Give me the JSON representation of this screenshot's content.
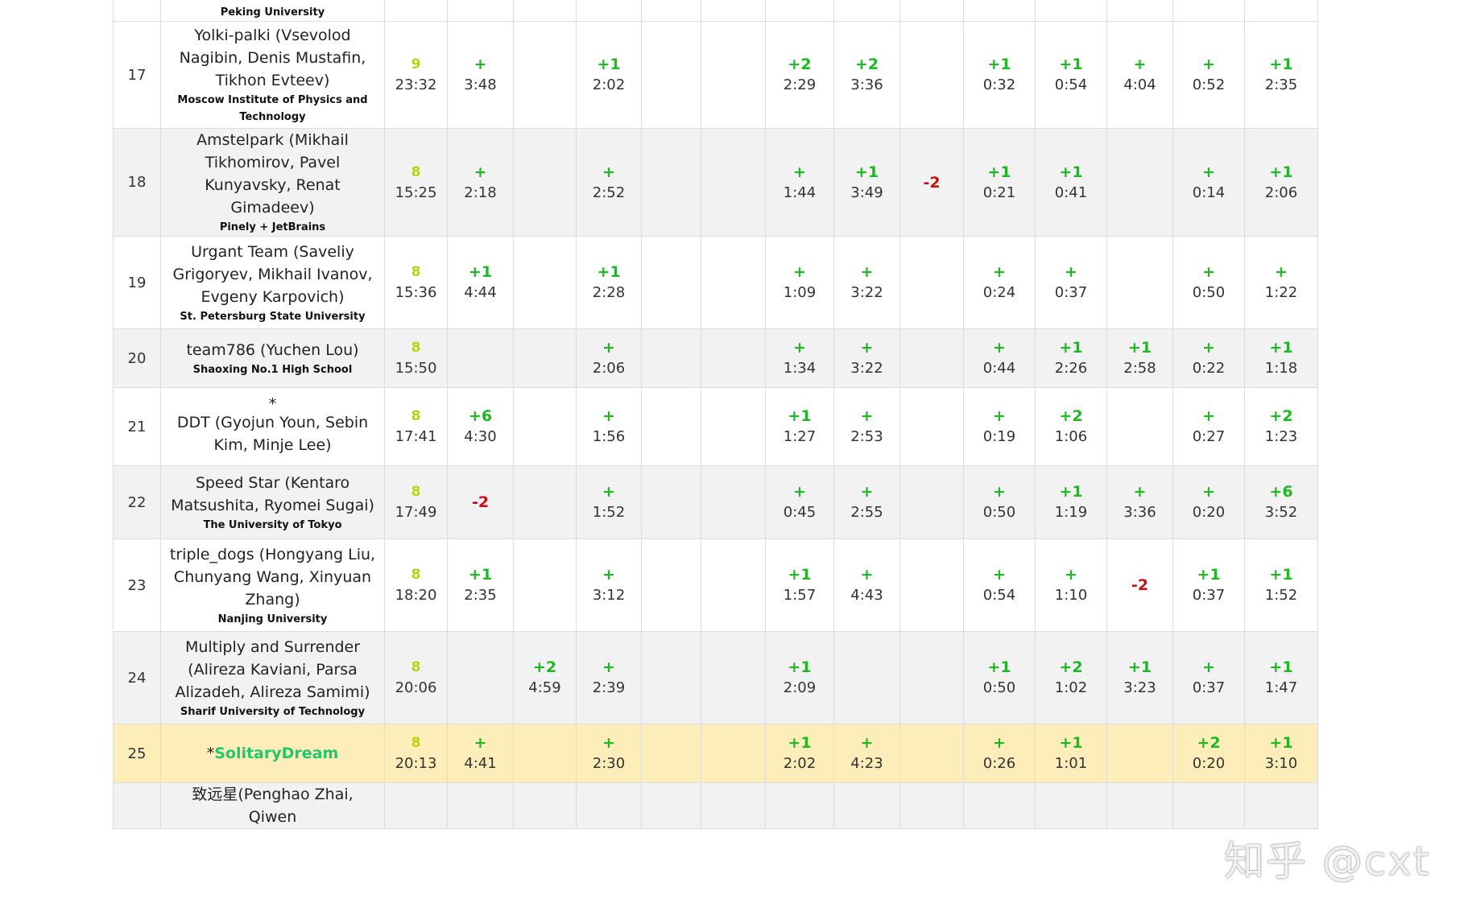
{
  "colors": {
    "solved": "#b8d21a",
    "accepted": "#1db822",
    "failed": "#c81010",
    "highlight_row": "#fdedb9",
    "highlight_team": "#22c76b"
  },
  "scoreboard": {
    "rows": [
      {
        "rank": "",
        "team": "",
        "affiliation": "Peking University",
        "solved": "",
        "penalty": "",
        "problems": [
          null,
          null,
          null,
          null,
          null,
          null,
          null,
          null,
          null,
          null,
          null,
          null,
          null,
          null
        ]
      },
      {
        "rank": "17",
        "team": "Yolki-palki (Vsevolod Nagibin, Denis Mustafin, Tikhon Evteev)",
        "affiliation": "Moscow Institute of Physics and Technology",
        "solved": "9",
        "penalty": "23:32",
        "problems": [
          {
            "r": "+",
            "t": "3:48"
          },
          null,
          {
            "r": "+1",
            "t": "2:02"
          },
          null,
          null,
          {
            "r": "+2",
            "t": "2:29"
          },
          {
            "r": "+2",
            "t": "3:36"
          },
          null,
          {
            "r": "+1",
            "t": "0:32"
          },
          {
            "r": "+1",
            "t": "0:54"
          },
          {
            "r": "+",
            "t": "4:04"
          },
          {
            "r": "+",
            "t": "0:52"
          },
          {
            "r": "+1",
            "t": "2:35"
          }
        ]
      },
      {
        "rank": "18",
        "team": "Amstelpark (Mikhail Tikhomirov, Pavel Kunyavsky, Renat Gimadeev)",
        "affiliation": "Pinely + JetBrains",
        "solved": "8",
        "penalty": "15:25",
        "problems": [
          {
            "r": "+",
            "t": "2:18"
          },
          null,
          {
            "r": "+",
            "t": "2:52"
          },
          null,
          null,
          {
            "r": "+",
            "t": "1:44"
          },
          {
            "r": "+1",
            "t": "3:49"
          },
          {
            "f": "-2"
          },
          {
            "r": "+1",
            "t": "0:21"
          },
          {
            "r": "+1",
            "t": "0:41"
          },
          null,
          {
            "r": "+",
            "t": "0:14"
          },
          {
            "r": "+1",
            "t": "2:06"
          }
        ]
      },
      {
        "rank": "19",
        "team": "Urgant Team (Saveliy Grigoryev, Mikhail Ivanov, Evgeny Karpovich)",
        "affiliation": "St. Petersburg State University",
        "solved": "8",
        "penalty": "15:36",
        "problems": [
          {
            "r": "+1",
            "t": "4:44"
          },
          null,
          {
            "r": "+1",
            "t": "2:28"
          },
          null,
          null,
          {
            "r": "+",
            "t": "1:09"
          },
          {
            "r": "+",
            "t": "3:22"
          },
          null,
          {
            "r": "+",
            "t": "0:24"
          },
          {
            "r": "+",
            "t": "0:37"
          },
          null,
          {
            "r": "+",
            "t": "0:50"
          },
          {
            "r": "+",
            "t": "1:22"
          }
        ]
      },
      {
        "rank": "20",
        "team": "team786 (Yuchen Lou)",
        "affiliation": "Shaoxing No.1 High School",
        "solved": "8",
        "penalty": "15:50",
        "problems": [
          null,
          null,
          {
            "r": "+",
            "t": "2:06"
          },
          null,
          null,
          {
            "r": "+",
            "t": "1:34"
          },
          {
            "r": "+",
            "t": "3:22"
          },
          null,
          {
            "r": "+",
            "t": "0:44"
          },
          {
            "r": "+1",
            "t": "2:26"
          },
          {
            "r": "+1",
            "t": "2:58"
          },
          {
            "r": "+",
            "t": "0:22"
          },
          {
            "r": "+1",
            "t": "1:18"
          }
        ]
      },
      {
        "rank": "21",
        "star": "*",
        "team": "DDT (Gyojun Youn, Sebin Kim, Minje Lee)",
        "affiliation": "",
        "solved": "8",
        "penalty": "17:41",
        "problems": [
          {
            "r": "+6",
            "t": "4:30"
          },
          null,
          {
            "r": "+",
            "t": "1:56"
          },
          null,
          null,
          {
            "r": "+1",
            "t": "1:27"
          },
          {
            "r": "+",
            "t": "2:53"
          },
          null,
          {
            "r": "+",
            "t": "0:19"
          },
          {
            "r": "+2",
            "t": "1:06"
          },
          null,
          {
            "r": "+",
            "t": "0:27"
          },
          {
            "r": "+2",
            "t": "1:23"
          }
        ]
      },
      {
        "rank": "22",
        "team": "Speed Star (Kentaro Matsushita, Ryomei Sugai)",
        "affiliation": "The University of Tokyo",
        "solved": "8",
        "penalty": "17:49",
        "problems": [
          {
            "f": "-2"
          },
          null,
          {
            "r": "+",
            "t": "1:52"
          },
          null,
          null,
          {
            "r": "+",
            "t": "0:45"
          },
          {
            "r": "+",
            "t": "2:55"
          },
          null,
          {
            "r": "+",
            "t": "0:50"
          },
          {
            "r": "+1",
            "t": "1:19"
          },
          {
            "r": "+",
            "t": "3:36"
          },
          {
            "r": "+",
            "t": "0:20"
          },
          {
            "r": "+6",
            "t": "3:52"
          }
        ]
      },
      {
        "rank": "23",
        "team": "triple_dogs (Hongyang Liu, Chunyang Wang, Xinyuan Zhang)",
        "affiliation": "Nanjing University",
        "solved": "8",
        "penalty": "18:20",
        "problems": [
          {
            "r": "+1",
            "t": "2:35"
          },
          null,
          {
            "r": "+",
            "t": "3:12"
          },
          null,
          null,
          {
            "r": "+1",
            "t": "1:57"
          },
          {
            "r": "+",
            "t": "4:43"
          },
          null,
          {
            "r": "+",
            "t": "0:54"
          },
          {
            "r": "+",
            "t": "1:10"
          },
          {
            "f": "-2"
          },
          {
            "r": "+1",
            "t": "0:37"
          },
          {
            "r": "+1",
            "t": "1:52"
          }
        ]
      },
      {
        "rank": "24",
        "team": "Multiply and Surrender (Alireza Kaviani, Parsa Alizadeh, Alireza Samimi)",
        "affiliation": "Sharif University of Technology",
        "solved": "8",
        "penalty": "20:06",
        "problems": [
          null,
          {
            "r": "+2",
            "t": "4:59"
          },
          {
            "r": "+",
            "t": "2:39"
          },
          null,
          null,
          {
            "r": "+1",
            "t": "2:09"
          },
          null,
          null,
          {
            "r": "+1",
            "t": "0:50"
          },
          {
            "r": "+2",
            "t": "1:02"
          },
          {
            "r": "+1",
            "t": "3:23"
          },
          {
            "r": "+",
            "t": "0:37"
          },
          {
            "r": "+1",
            "t": "1:47"
          }
        ]
      },
      {
        "rank": "25",
        "star": "*",
        "team": "SolitaryDream",
        "affiliation": "",
        "solved": "8",
        "penalty": "20:13",
        "highlight": true,
        "problems": [
          {
            "r": "+",
            "t": "4:41"
          },
          null,
          {
            "r": "+",
            "t": "2:30"
          },
          null,
          null,
          {
            "r": "+1",
            "t": "2:02"
          },
          {
            "r": "+",
            "t": "4:23"
          },
          null,
          {
            "r": "+",
            "t": "0:26"
          },
          {
            "r": "+1",
            "t": "1:01"
          },
          null,
          {
            "r": "+2",
            "t": "0:20"
          },
          {
            "r": "+1",
            "t": "3:10"
          }
        ]
      },
      {
        "rank": "",
        "team": "致远星(Penghao Zhai, Qiwen",
        "affiliation": "",
        "solved": "",
        "penalty": "",
        "problems": [
          null,
          null,
          null,
          null,
          null,
          null,
          null,
          null,
          null,
          null,
          null,
          null,
          null
        ]
      }
    ]
  },
  "watermark": "知乎 @cxt"
}
